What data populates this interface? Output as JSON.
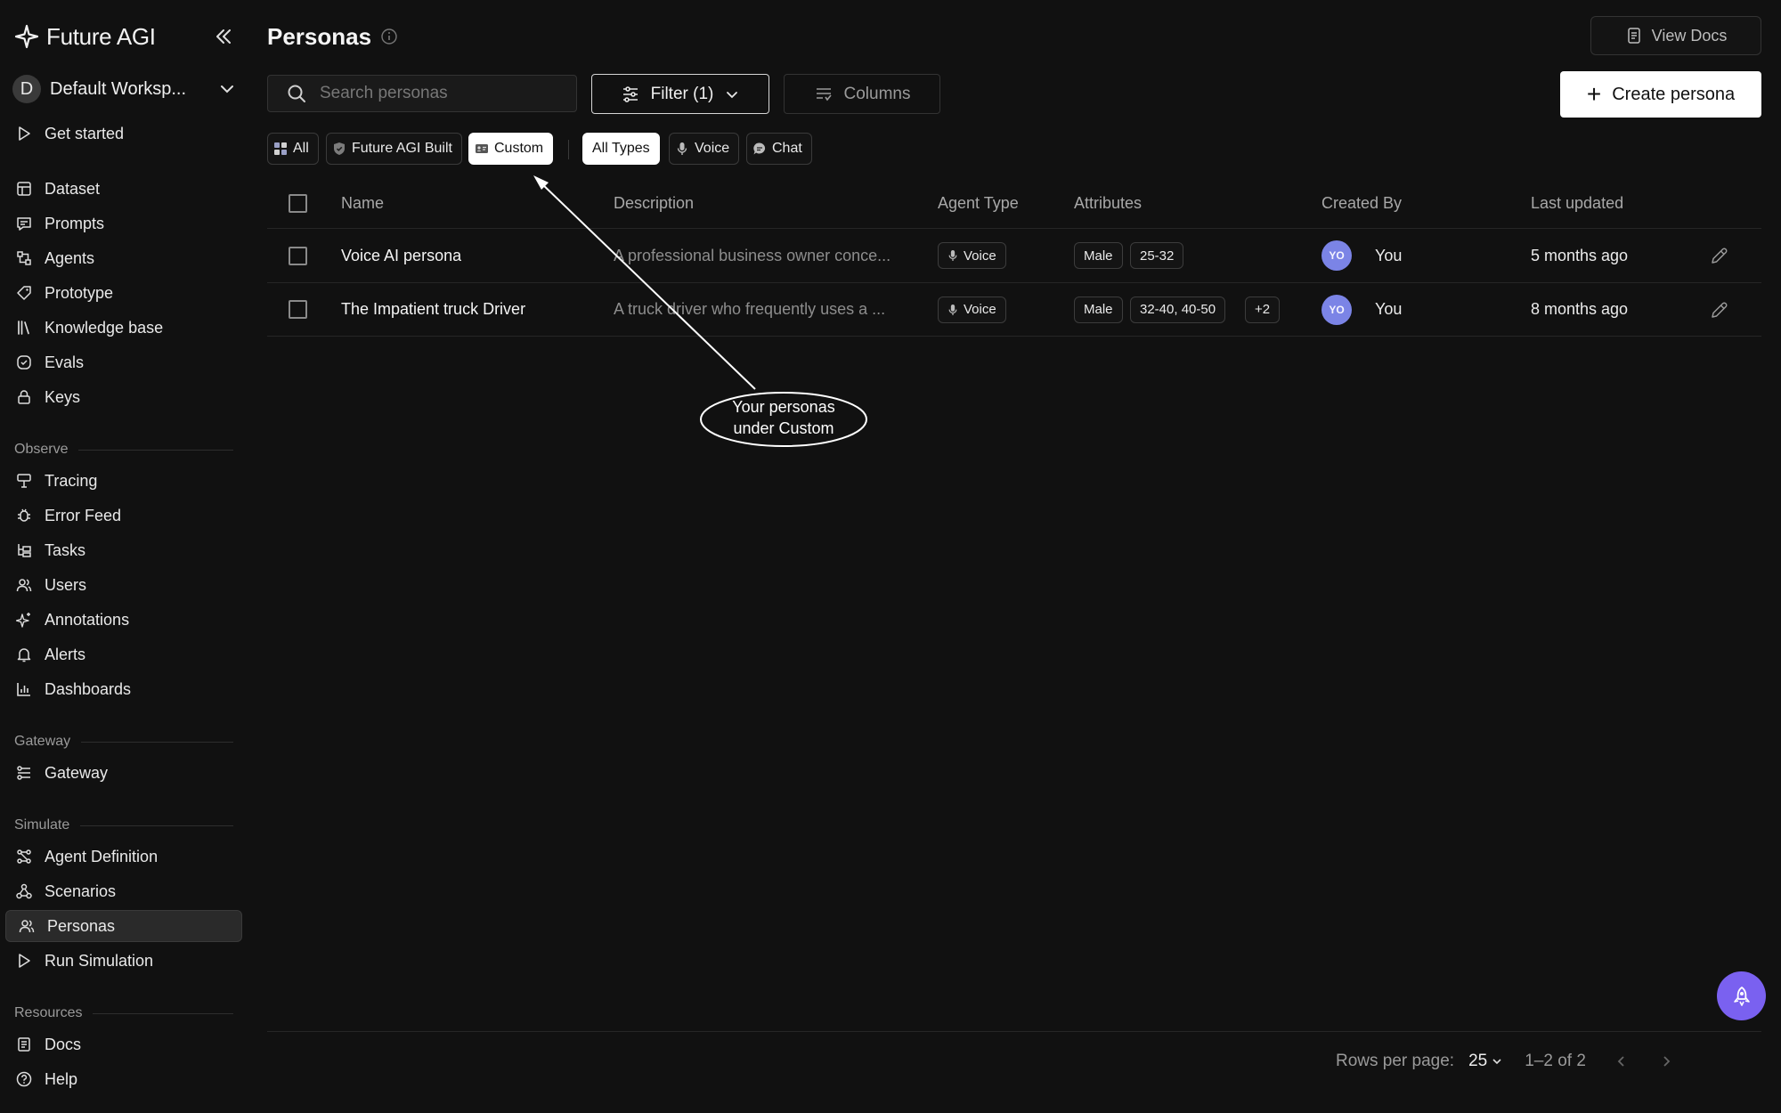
{
  "app": {
    "name": "Future AGI"
  },
  "workspace": {
    "initial": "D",
    "name": "Default Worksp..."
  },
  "sidebar": {
    "top_items": [
      {
        "label": "Get started",
        "icon": "play-icon"
      }
    ],
    "main_items": [
      {
        "label": "Dataset",
        "icon": "table-icon"
      },
      {
        "label": "Prompts",
        "icon": "prompt-icon"
      },
      {
        "label": "Agents",
        "icon": "agents-icon"
      },
      {
        "label": "Prototype",
        "icon": "tag-icon"
      },
      {
        "label": "Knowledge base",
        "icon": "books-icon"
      },
      {
        "label": "Evals",
        "icon": "check-circle-icon"
      },
      {
        "label": "Keys",
        "icon": "lock-icon"
      }
    ],
    "sections": {
      "observe": "Observe",
      "gateway": "Gateway",
      "simulate": "Simulate",
      "resources": "Resources"
    },
    "observe_items": [
      {
        "label": "Tracing",
        "icon": "tracing-icon"
      },
      {
        "label": "Error Feed",
        "icon": "bug-icon"
      },
      {
        "label": "Tasks",
        "icon": "tasks-icon"
      },
      {
        "label": "Users",
        "icon": "users-icon"
      },
      {
        "label": "Annotations",
        "icon": "sparkle-icon"
      },
      {
        "label": "Alerts",
        "icon": "bell-icon"
      },
      {
        "label": "Dashboards",
        "icon": "bar-chart-icon"
      }
    ],
    "gateway_items": [
      {
        "label": "Gateway",
        "icon": "gateway-icon"
      }
    ],
    "simulate_items": [
      {
        "label": "Agent Definition",
        "icon": "agent-def-icon"
      },
      {
        "label": "Scenarios",
        "icon": "scenarios-icon"
      },
      {
        "label": "Personas",
        "icon": "personas-icon",
        "active": true
      },
      {
        "label": "Run Simulation",
        "icon": "play-icon"
      }
    ],
    "resources_items": [
      {
        "label": "Docs",
        "icon": "docs-icon"
      },
      {
        "label": "Help",
        "icon": "help-icon"
      }
    ]
  },
  "header": {
    "title": "Personas",
    "view_docs": "View Docs"
  },
  "toolbar": {
    "search_placeholder": "Search personas",
    "filter_label": "Filter (1)",
    "columns_label": "Columns",
    "create_label": "Create persona"
  },
  "chips": {
    "source": [
      {
        "label": "All",
        "icon": "grid-icon",
        "selected": false
      },
      {
        "label": "Future AGI Built",
        "icon": "shield-icon",
        "selected": false
      },
      {
        "label": "Custom",
        "icon": "id-card-icon",
        "selected": true
      }
    ],
    "type": [
      {
        "label": "All Types",
        "selected": true
      },
      {
        "label": "Voice",
        "icon": "mic-icon",
        "selected": false
      },
      {
        "label": "Chat",
        "icon": "chat-bubble-icon",
        "selected": false
      }
    ]
  },
  "table": {
    "columns": [
      "Name",
      "Description",
      "Agent Type",
      "Attributes",
      "Created By",
      "Last updated"
    ],
    "rows": [
      {
        "name": "Voice AI persona",
        "description": "A professional business owner conce...",
        "agent_type": "Voice",
        "attributes": [
          "Male",
          "25-32"
        ],
        "created_by_initials": "YO",
        "created_by": "You",
        "last_updated": "5 months ago"
      },
      {
        "name": "The Impatient truck Driver",
        "description": "A truck driver who frequently uses a ...",
        "agent_type": "Voice",
        "attributes": [
          "Male",
          "32-40, 40-50",
          "+2"
        ],
        "created_by_initials": "YO",
        "created_by": "You",
        "last_updated": "8 months ago"
      }
    ]
  },
  "annotation": {
    "line1": "Your personas",
    "line2": "under Custom"
  },
  "pagination": {
    "rows_per_page_label": "Rows per page:",
    "rows_per_page_value": "25",
    "range": "1–2 of 2"
  },
  "colors": {
    "background": "#111111",
    "accent_fab": "#7a61f0",
    "avatar": "#7b84e6"
  }
}
